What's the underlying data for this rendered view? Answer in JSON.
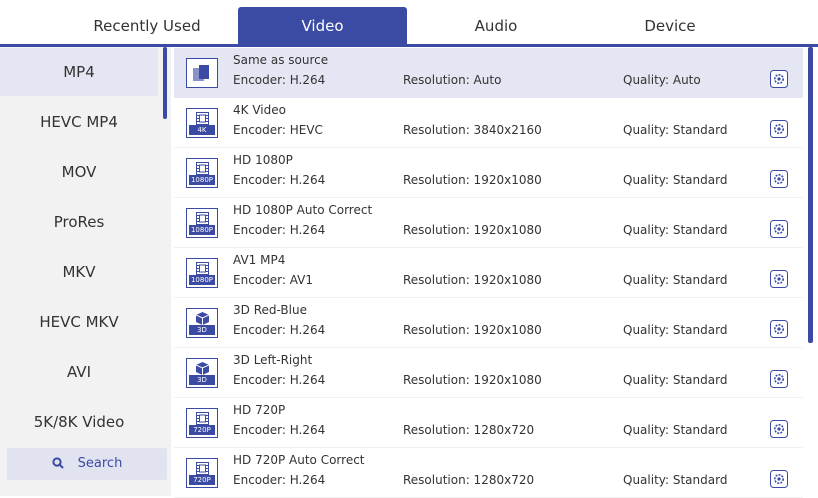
{
  "tabs": [
    {
      "label": "Recently Used"
    },
    {
      "label": "Video"
    },
    {
      "label": "Audio"
    },
    {
      "label": "Device"
    }
  ],
  "sidebar": {
    "items": [
      {
        "label": "MP4"
      },
      {
        "label": "HEVC MP4"
      },
      {
        "label": "MOV"
      },
      {
        "label": "ProRes"
      },
      {
        "label": "MKV"
      },
      {
        "label": "HEVC MKV"
      },
      {
        "label": "AVI"
      },
      {
        "label": "5K/8K Video"
      }
    ],
    "search_label": "Search"
  },
  "formats": [
    {
      "name": "Same as source",
      "encoder": "Encoder: H.264",
      "resolution": "Resolution: Auto",
      "quality": "Quality: Auto",
      "badge": "",
      "icon": "layers-icon"
    },
    {
      "name": "4K Video",
      "encoder": "Encoder: HEVC",
      "resolution": "Resolution: 3840x2160",
      "quality": "Quality: Standard",
      "badge": "4K",
      "icon": "film-icon"
    },
    {
      "name": "HD 1080P",
      "encoder": "Encoder: H.264",
      "resolution": "Resolution: 1920x1080",
      "quality": "Quality: Standard",
      "badge": "1080P",
      "icon": "film-icon"
    },
    {
      "name": "HD 1080P Auto Correct",
      "encoder": "Encoder: H.264",
      "resolution": "Resolution: 1920x1080",
      "quality": "Quality: Standard",
      "badge": "1080P",
      "icon": "film-icon"
    },
    {
      "name": "AV1 MP4",
      "encoder": "Encoder: AV1",
      "resolution": "Resolution: 1920x1080",
      "quality": "Quality: Standard",
      "badge": "1080P",
      "icon": "film-icon"
    },
    {
      "name": "3D Red-Blue",
      "encoder": "Encoder: H.264",
      "resolution": "Resolution: 1920x1080",
      "quality": "Quality: Standard",
      "badge": "3D",
      "icon": "cube-icon"
    },
    {
      "name": "3D Left-Right",
      "encoder": "Encoder: H.264",
      "resolution": "Resolution: 1920x1080",
      "quality": "Quality: Standard",
      "badge": "3D",
      "icon": "cube-icon"
    },
    {
      "name": "HD 720P",
      "encoder": "Encoder: H.264",
      "resolution": "Resolution: 1280x720",
      "quality": "Quality: Standard",
      "badge": "720P",
      "icon": "film-icon"
    },
    {
      "name": "HD 720P Auto Correct",
      "encoder": "Encoder: H.264",
      "resolution": "Resolution: 1280x720",
      "quality": "Quality: Standard",
      "badge": "720P",
      "icon": "film-icon"
    }
  ],
  "colors": {
    "accent": "#3b4aa3",
    "selected_bg": "#e4e6f3",
    "sidebar_bg": "#f2f2f2"
  }
}
